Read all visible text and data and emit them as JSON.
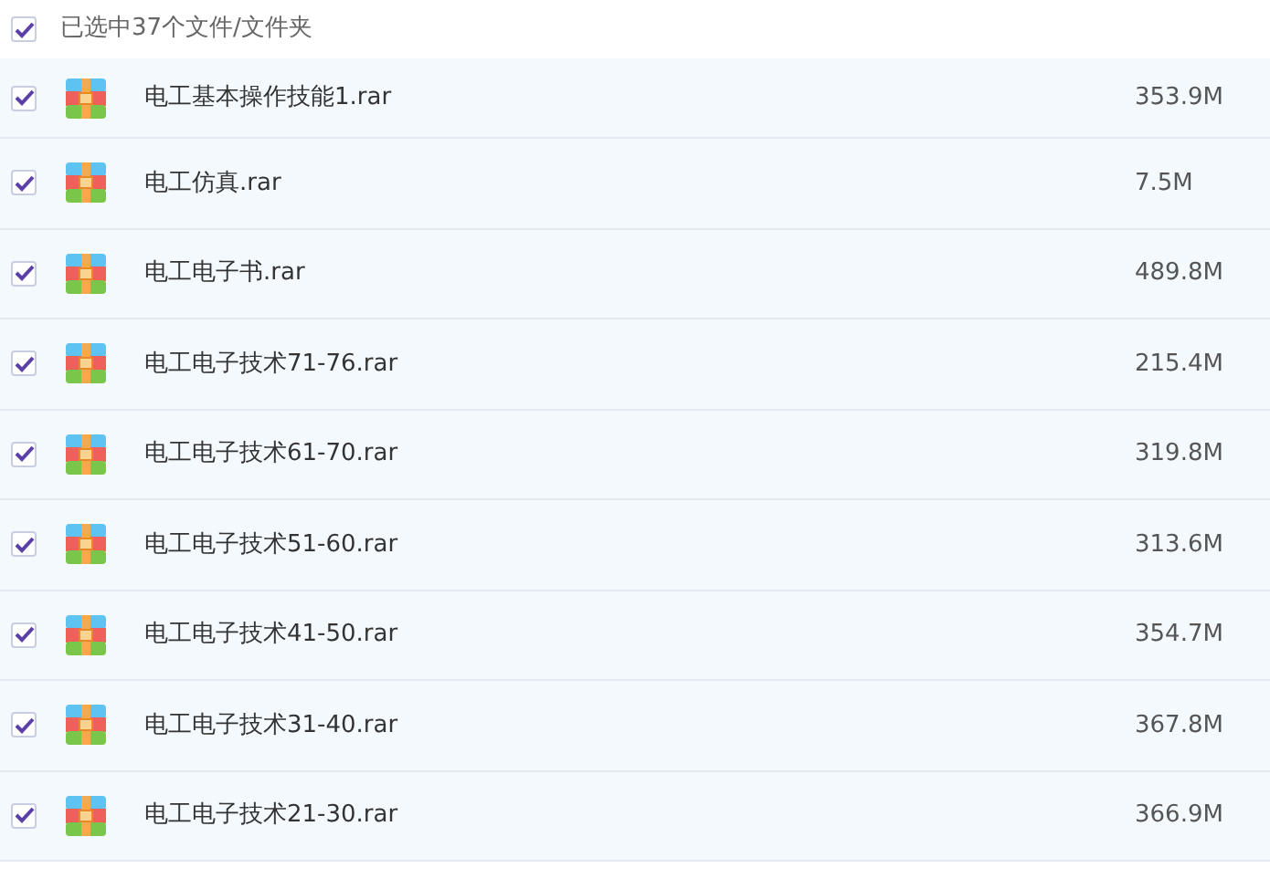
{
  "header": {
    "checked": true,
    "label": "已选中37个文件/文件夹"
  },
  "files": [
    {
      "name": "电工基本操作技能1.rar",
      "size": "353.9M",
      "checked": true
    },
    {
      "name": "电工仿真.rar",
      "size": "7.5M",
      "checked": true
    },
    {
      "name": "电工电子书.rar",
      "size": "489.8M",
      "checked": true
    },
    {
      "name": "电工电子技术71-76.rar",
      "size": "215.4M",
      "checked": true
    },
    {
      "name": "电工电子技术61-70.rar",
      "size": "319.8M",
      "checked": true
    },
    {
      "name": "电工电子技术51-60.rar",
      "size": "313.6M",
      "checked": true
    },
    {
      "name": "电工电子技术41-50.rar",
      "size": "354.7M",
      "checked": true
    },
    {
      "name": "电工电子技术31-40.rar",
      "size": "367.8M",
      "checked": true
    },
    {
      "name": "电工电子技术21-30.rar",
      "size": "366.9M",
      "checked": true
    }
  ]
}
